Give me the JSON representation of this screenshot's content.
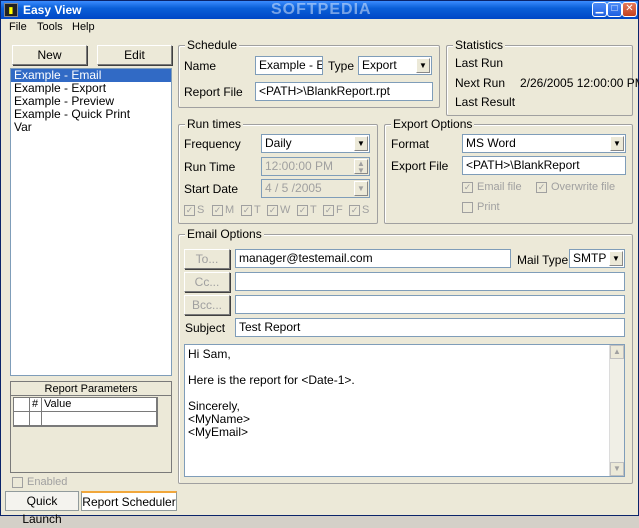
{
  "window": {
    "title": "Easy View",
    "watermark": "SOFTPEDIA"
  },
  "menu": {
    "items": [
      "File",
      "Tools",
      "Help"
    ]
  },
  "left": {
    "new_label": "New",
    "edit_label": "Edit",
    "list": [
      "Example - Email",
      "Example - Export",
      "Example - Preview",
      "Example - Quick Print",
      "Var"
    ],
    "selected_index": 0,
    "params_title": "Report Parameters",
    "params_col_num": "#",
    "params_col_value": "Value",
    "enabled_label": "Enabled"
  },
  "tabs": [
    "Quick Launch",
    "Report Scheduler"
  ],
  "schedule": {
    "title": "Schedule",
    "name_label": "Name",
    "name_value": "Example - E",
    "type_label": "Type",
    "type_value": "Export",
    "report_file_label": "Report File",
    "report_file_value": "<PATH>\\BlankReport.rpt"
  },
  "statistics": {
    "title": "Statistics",
    "last_run_label": "Last Run",
    "next_run_label": "Next Run",
    "next_run_value": "2/26/2005 12:00:00 PM",
    "last_result_label": "Last Result"
  },
  "run_times": {
    "title": "Run times",
    "frequency_label": "Frequency",
    "frequency_value": "Daily",
    "run_time_label": "Run Time",
    "run_time_value": "12:00:00 PM",
    "start_date_label": "Start Date",
    "start_date_value": "4 / 5 /2005",
    "days": [
      "S",
      "M",
      "T",
      "W",
      "T",
      "F",
      "S"
    ]
  },
  "export_options": {
    "title": "Export Options",
    "format_label": "Format",
    "format_value": "MS Word",
    "export_file_label": "Export File",
    "export_file_value": "<PATH>\\BlankReport",
    "email_file_label": "Email file",
    "overwrite_file_label": "Overwrite file",
    "print_label": "Print"
  },
  "email_options": {
    "title": "Email Options",
    "to_label": "To...",
    "to_value": "manager@testemail.com",
    "cc_label": "Cc...",
    "bcc_label": "Bcc...",
    "mail_type_label": "Mail Type",
    "mail_type_value": "SMTP",
    "subject_label": "Subject",
    "subject_value": "Test Report",
    "body_lines": [
      "Hi Sam,",
      "",
      "Here is the report for <Date-1>.",
      "",
      "Sincerely,",
      "<MyName>",
      "<MyEmail>"
    ]
  }
}
